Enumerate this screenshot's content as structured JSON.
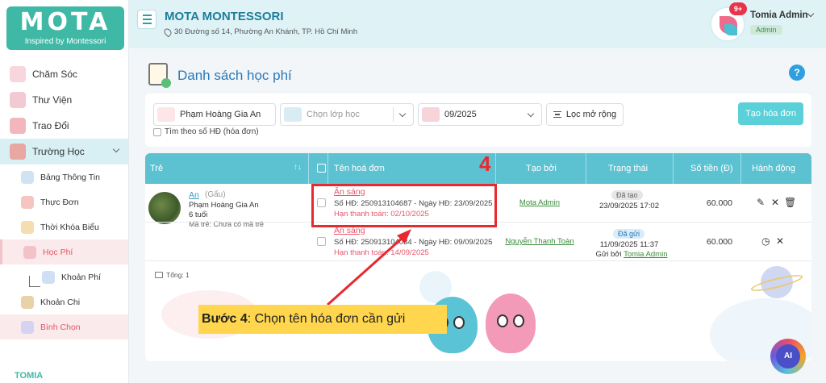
{
  "brand": {
    "logo_text": "MOTA",
    "logo_sub": "Inspired by Montessori",
    "footer_logo": "TOMIA"
  },
  "header": {
    "school_name": "MOTA MONTESSORI",
    "address": "30 Đường số 14, Phường An Khánh, TP. Hồ Chí Minh",
    "notification_count": "9+",
    "user_name": "Tomia Admin",
    "user_role": "Admin"
  },
  "sidebar": {
    "items": [
      {
        "label": "Chăm Sóc",
        "icon": "care-icon"
      },
      {
        "label": "Thư Viện",
        "icon": "library-icon"
      },
      {
        "label": "Trao Đổi",
        "icon": "chat-icon"
      },
      {
        "label": "Trường Học",
        "icon": "school-icon"
      },
      {
        "label": "Bảng Thông Tin",
        "icon": "megaphone-icon"
      },
      {
        "label": "Thực Đơn",
        "icon": "menu-food-icon"
      },
      {
        "label": "Thời Khóa Biểu",
        "icon": "schedule-icon"
      },
      {
        "label": "Học Phí",
        "icon": "tuition-icon"
      },
      {
        "label": "Khoản Phí",
        "icon": "fee-icon"
      },
      {
        "label": "Khoản Chi",
        "icon": "expense-icon"
      },
      {
        "label": "Bình Chọn",
        "icon": "vote-icon"
      }
    ]
  },
  "page": {
    "title": "Danh sách học phí",
    "help": "?"
  },
  "filters": {
    "student_value": "Phạm Hoàng Gia An",
    "class_placeholder": "Chọn lớp học",
    "month_value": "09/2025",
    "advanced_filter_label": "Lọc mở rộng",
    "create_button_label": "Tạo hóa đơn",
    "search_by_invoice_label": "Tìm theo số HĐ (hóa đơn)"
  },
  "table": {
    "columns": [
      "Trẻ",
      "Tên hoá đơn",
      "Tạo bởi",
      "Trạng thái",
      "Số tiền (Đ)",
      "Hành động"
    ],
    "student": {
      "name": "An",
      "class": "(Gấu)",
      "parent": "Phạm Hoàng Gia An",
      "age": "6 tuổi",
      "code": "Mã trẻ: Chưa có mã trẻ"
    },
    "rows": [
      {
        "invoice_name": "Ăn sáng",
        "invoice_no": "Số HĐ: 250913104687 - Ngày HĐ: 23/09/2025",
        "due": "Hạn thanh toán: 02/10/2025",
        "created_by": "Mota Admin",
        "status": "Đã tạo",
        "status_time": "23/09/2025 17:02",
        "amount": "60.000"
      },
      {
        "invoice_name": "Ăn sáng",
        "invoice_no": "Số HĐ: 250913104084 - Ngày HĐ: 09/09/2025",
        "due": "Hạn thanh toán: 14/09/2025",
        "created_by": "Nguyễn Thanh Toàn",
        "status": "Đã gửi",
        "status_time": "11/09/2025 11:37",
        "sent_by_prefix": "Gửi bởi",
        "sent_by": "Tomia Admin",
        "amount": "60.000"
      }
    ],
    "total_label": "Tổng: 1"
  },
  "annotation": {
    "step_number": "4",
    "step_prefix": "Bước 4",
    "step_text": ": Chọn tên hóa đơn cần gửi",
    "color": "#e8292f"
  },
  "ai_button": "AI",
  "colors": {
    "accent": "#5cc2d1",
    "brand": "#3fb8a6",
    "danger": "#e8556b"
  }
}
